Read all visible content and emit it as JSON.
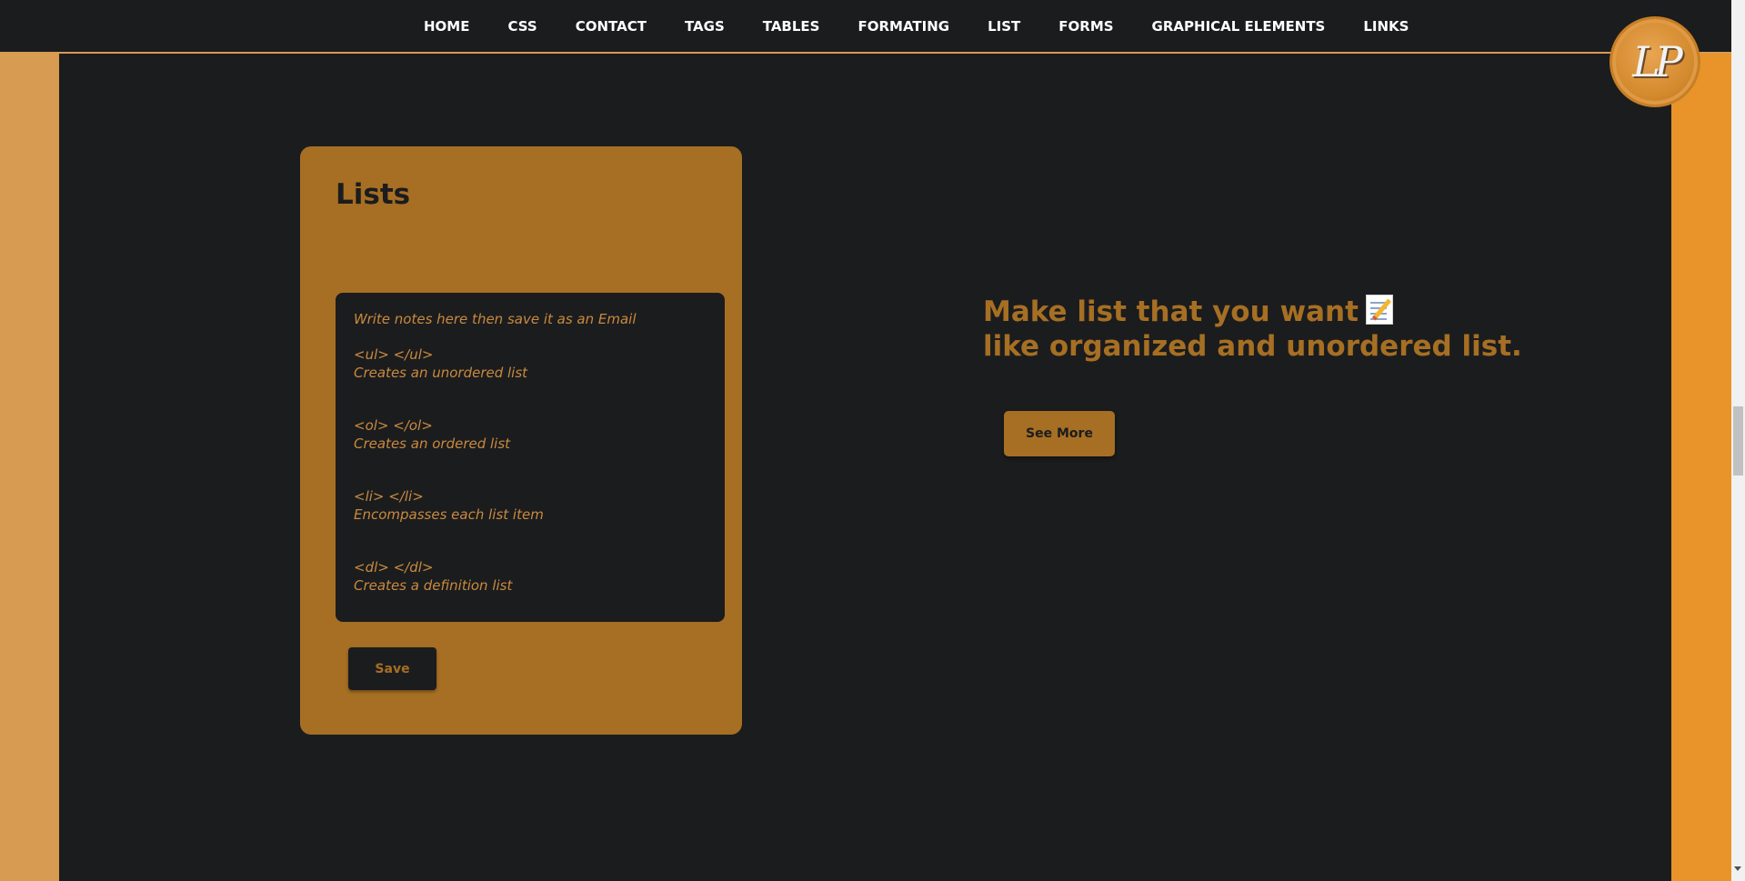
{
  "nav": {
    "items": [
      {
        "label": "HOME"
      },
      {
        "label": "CSS"
      },
      {
        "label": "CONTACT"
      },
      {
        "label": "TAGS"
      },
      {
        "label": "TABLES"
      },
      {
        "label": "FORMATING"
      },
      {
        "label": "LIST"
      },
      {
        "label": "FORMS"
      },
      {
        "label": "GRAPHICAL ELEMENTS"
      },
      {
        "label": "LINKS"
      }
    ]
  },
  "logo": {
    "text": "LP"
  },
  "card": {
    "title": "Lists",
    "notes_value": "Write notes here then save it as an Email\n\n<ul> </ul>\nCreates an unordered list\n\n\n<ol> </ol>\nCreates an ordered list\n\n\n<li> </li>\nEncompasses each list item\n\n\n<dl> </dl>\nCreates a definition list",
    "save_label": "Save"
  },
  "promo": {
    "line1": "Make list that you want",
    "line1_icon": "memo-icon",
    "line2": "like organized and unordered list.",
    "button_label": "See More"
  },
  "colors": {
    "background": "#1b1c1e",
    "accent": "#a66f23",
    "left_stripe": "#d89b52",
    "right_stripe": "#e8942a"
  }
}
